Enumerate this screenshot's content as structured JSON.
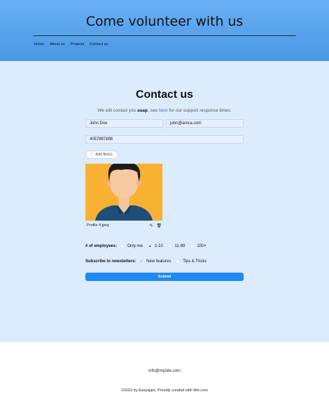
{
  "header": {
    "title": "Come volunteer with us",
    "nav": [
      "Home",
      "About us",
      "Projects",
      "Contact us"
    ]
  },
  "contact": {
    "title": "Contact us",
    "subtitle_pre": "We will contact you ",
    "subtitle_bold": "asap",
    "subtitle_mid": ", see ",
    "subtitle_link": "here",
    "subtitle_post": " for our support response times.",
    "name_value": "John Doe",
    "email_value": "john@amca.com",
    "phone_value": "4057897898",
    "upload_label": "Add file(s)",
    "file_name": "Profile 4.jpeg",
    "employees_label": "# of employees:",
    "employee_options": [
      "Only me",
      "2-10",
      "11-99",
      "100+"
    ],
    "employees_selected": "2-10",
    "newsletter_label": "Subscribe to newsletters:",
    "newsletter_options": [
      "New features",
      "Tips & Tricks"
    ],
    "submit_label": "Submit"
  },
  "footer": {
    "email": "info@mysite.com",
    "copyright": "©2022 by Easyapps. Proudly created with Wix.com"
  },
  "colors": {
    "header_top": "#6ab0f3",
    "header_bottom": "#4a97e6",
    "page_bg": "#dcecfd",
    "accent": "#1e8af5",
    "image_bg": "#f8b133"
  },
  "icons": [
    "paperclip-icon",
    "edit-icon",
    "trash-icon",
    "check-icon"
  ]
}
